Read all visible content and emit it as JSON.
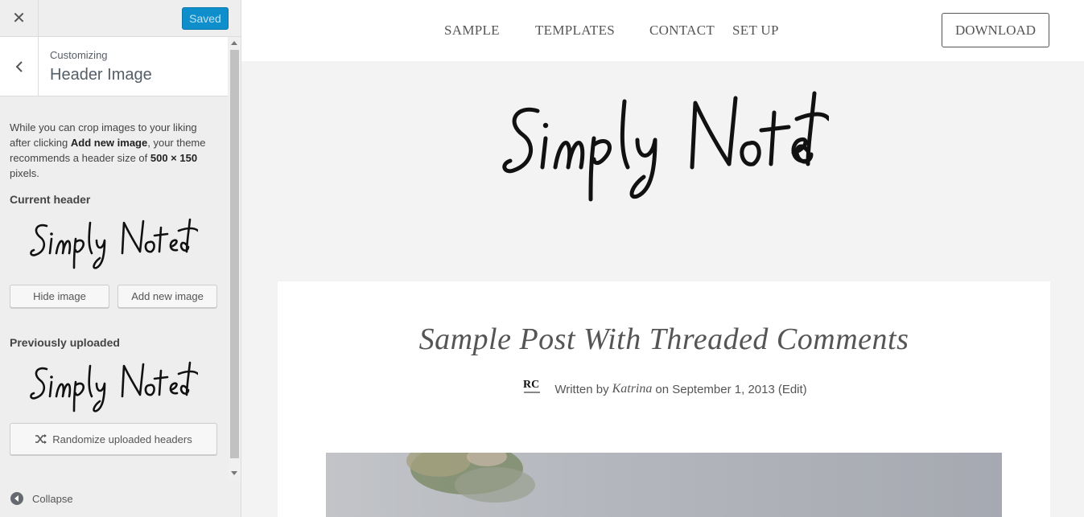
{
  "sidebar": {
    "saved_label": "Saved",
    "breadcrumb": "Customizing",
    "section_title": "Header Image",
    "description": {
      "part1": "While you can crop images to your liking after clicking ",
      "bold1": "Add new image",
      "part2": ", your theme recommends a header size of ",
      "bold2": "500 × 150",
      "part3": " pixels."
    },
    "current_header_label": "Current header",
    "hide_image_label": "Hide image",
    "add_new_image_label": "Add new image",
    "previously_uploaded_label": "Previously uploaded",
    "randomize_label": "Randomize uploaded headers",
    "collapse_label": "Collapse",
    "signature_text": "Simply Noted"
  },
  "preview": {
    "nav": {
      "items": [
        "SAMPLE",
        "TEMPLATES",
        "CONTACT",
        "SET UP"
      ],
      "download_label": "DOWNLOAD"
    },
    "site_logo_text": "Simply Noted",
    "post": {
      "title": "Sample Post With Threaded Comments",
      "written_by": "Written by",
      "author": "Katrina",
      "date_prefix": "on",
      "date": "September 1, 2013",
      "edit_label": "(Edit)",
      "avatar_initials": "RC"
    }
  },
  "colors": {
    "accent": "#0e8ecb",
    "sidebar_bg": "#eeeeee",
    "preview_bg": "#f3f3f3"
  }
}
